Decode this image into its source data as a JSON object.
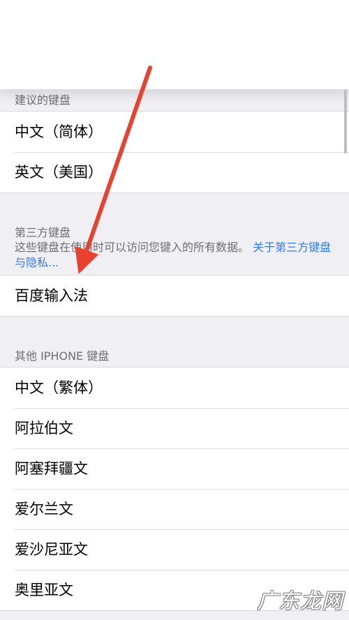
{
  "suggested": {
    "header": "建议的键盘",
    "items": [
      {
        "label": "中文（简体）"
      },
      {
        "label": "英文（美国）"
      }
    ]
  },
  "third_party": {
    "header": "第三方键盘",
    "note": "这些键盘在使用时可以访问您键入的所有数据。",
    "note_link": "关于第三方键盘与隐私...",
    "items": [
      {
        "label": "百度输入法"
      }
    ]
  },
  "other": {
    "header": "其他 IPHONE 键盘",
    "items": [
      {
        "label": "中文（繁体）"
      },
      {
        "label": "阿拉伯文"
      },
      {
        "label": "阿塞拜疆文"
      },
      {
        "label": "爱尔兰文"
      },
      {
        "label": "爱沙尼亚文"
      },
      {
        "label": "奥里亚文"
      }
    ]
  },
  "watermark": "广东龙网",
  "colors": {
    "background": "#efeff4",
    "header_text": "#6d6d72",
    "link": "#2f7cf6",
    "annotation_arrow": "#e8422f"
  }
}
